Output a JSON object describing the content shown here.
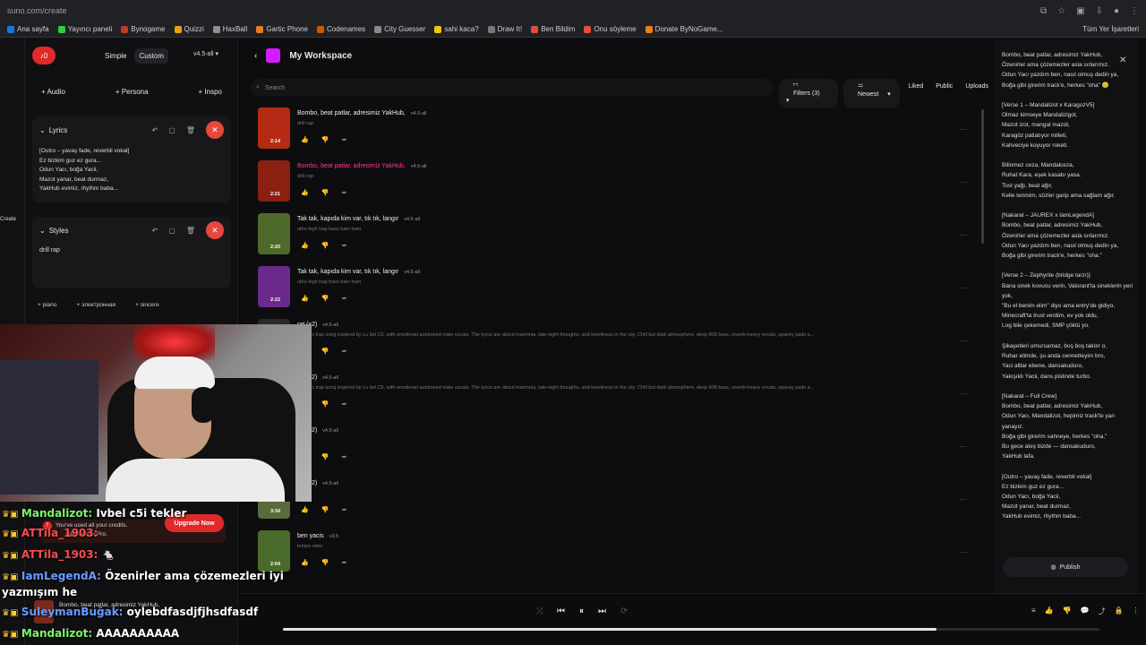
{
  "browser": {
    "url": "suno.com/create",
    "bookmarks": [
      "Ana sayfa",
      "Yayıncı paneli",
      "Bynogame",
      "Quizzi",
      "HaxBall",
      "Gartic Phone",
      "Codenames",
      "City Guesser",
      "sahi kaca?",
      "Draw It!",
      "Ben Bildim",
      "Onu söyleme",
      "Donate ByNoGame..."
    ],
    "bookmarks_right": "Tüm Yer İşaretleri"
  },
  "leftrail": {
    "create_label": "Create"
  },
  "creator": {
    "credits": "0",
    "mode_simple": "Simple",
    "mode_custom": "Custom",
    "version": "v4.5-all",
    "add_audio": "+ Audio",
    "add_persona": "+ Persona",
    "add_inspo": "+ Inspo",
    "lyrics_title": "Lyrics",
    "lyrics_text": "[Outro – yavaş fade, reverbli vokal]\nEz bizkim guz ez gura...\nOdun Yacı, boğa Yacii,\nMazot yanar, beat durmaz,\nYakHub evimiz, rhythm baba...",
    "styles_title": "Styles",
    "styles_text": "drill rap",
    "tags": [
      "+ piano",
      "+ электронная",
      "+ sincere"
    ]
  },
  "chat": [
    {
      "name": "Mandalizot:",
      "text": " Ivbel c5i tekler",
      "color": "green"
    },
    {
      "name": "ATTila_1903:",
      "text": " ",
      "color": "red"
    },
    {
      "name": "ATTila_1903:",
      "text": " 🐁",
      "color": "red"
    },
    {
      "name": "IamLegendA:",
      "text": " Özenirler ama çözemezleri iyi",
      "color": "blue"
    },
    {
      "name": "",
      "text": "yazmışım he",
      "color": "none"
    },
    {
      "name": "SuleymanBuğak:",
      "text": " oylebdfasdjfjhsdfasdf",
      "color": "blue"
    },
    {
      "name": "Mandalizot:",
      "text": " AAAAAAAAAA",
      "color": "green"
    }
  ],
  "toast": {
    "line1": "You've used all your credits.",
    "line2": "Upgrade to Pro.",
    "upgrade_label": "Upgrade Now"
  },
  "workspace": {
    "title": "My Workspace",
    "search_placeholder": "Search",
    "filters_label": "Filters (3)",
    "sort_label": "Newest",
    "liked": "Liked",
    "public": "Public",
    "uploads": "Uploads",
    "songs": [
      {
        "title": "Bombo, beat patlar, adresimiz YakHub,",
        "version": "v4.5-all",
        "desc": "drill rap",
        "duration": "2:14",
        "color": "#b52a14",
        "pink": false
      },
      {
        "title": "Bombo, beat patlar, adresimiz YakHub,",
        "version": "v4.5-all",
        "desc": "drill rap",
        "duration": "2:21",
        "color": "#8a1f12",
        "pink": true
      },
      {
        "title": "Tak tak, kapıda kim var, tık tık, langır",
        "version": "v4.5-all",
        "desc": "ultra high trap bass bam bam",
        "duration": "2:20",
        "color": "#4e6a2a",
        "pink": false
      },
      {
        "title": "Tak tak, kapıda kim var, tık tık, langır",
        "version": "v4.5-all",
        "desc": "ultra high trap bass bam bam",
        "duration": "2:22",
        "color": "#6a2a8a",
        "pink": false
      },
      {
        "title": "rat (x2)",
        "version": "v4.5-all",
        "desc": "melodic trap song inspired by Lu bel C5, with emotional autotuned male vocals. The lyrics are about insomnia, late-night thoughts, and loneliness in the city. Chill but dark atmosphere, deep 808 bass, reverb-heavy vocals, spacey pads a...",
        "duration": "",
        "color": "#2a2a2a",
        "pink": false
      },
      {
        "title": "rat (x2)",
        "version": "v4.5-all",
        "desc": "melodic trap song inspired by Lu bel C5, with emotional autotuned male vocals. The lyrics are about insomnia, late-night thoughts, and loneliness in the city. Chill but dark atmosphere, deep 808 bass, reverb-heavy vocals, spacey pads a...",
        "duration": "",
        "color": "#2a2a2a",
        "pink": false
      },
      {
        "title": "rat (x2)",
        "version": "v4.5-all",
        "desc": "vibe/",
        "duration": "",
        "color": "#2a2a2a",
        "pink": false
      },
      {
        "title": "rat (x2)",
        "version": "v4.5-all",
        "desc": "vibe/",
        "duration": "3:34",
        "color": "#5a6a3a",
        "pink": false
      },
      {
        "title": "ben yacis",
        "version": "v3.5",
        "desc": "tempo slow",
        "duration": "2:04",
        "color": "#4a6a2a",
        "pink": false
      }
    ]
  },
  "rightpanel": {
    "lyrics": "Bombo, beat patlar, adresimiz YakHub,\nÖzenirler ama çözemezler asla sırlarımız.\nOdun Yacı yazdım ben, nasıl olmuş dedin ya,\nBoğa gibi girerim track'e, herkes \"oha\" 😊\n\n[Verse 1 – Mandalizot x KaragozV5]\nOlmaz kimseye Mandalizigot,\nMazot izot, mangal mazot,\nKaragöz patlatıyor milleti,\nKahveciye koyuyor roketi.\n\nBilinmez ceza, Mandalceza,\nRuhat Kara, eşek kasabı yasa.\nTost yağı, beat ağır,\nKelle tenmim, sözler garip ama sağlam ağır.\n\n[Nakarat – JAUREX x IamLegendA]\nBombo, beat patlar, adresimiz YakHub,\nÖzenirler ama çözemezler asla sırlarımız.\nOdun Yacı yazdım ben, nasıl olmuş dedin ya,\nBoğa gibi girerim track'e, herkes \"oha.\"\n\n[Verse 2 – Zephyrite (bridge tarzı)]\nBana sinek kovucu verin, Valorant'ta sineklerin yeri yok,\n\"Bu el benim elim\" diyo ama entry'de gidiyo,\nMinecraft'ta trust verdim, ev yok oldu,\nLog bile çekemedi, SMP çöktü yo.\n\nŞikayetleri umursamaz, boş boş takılır o,\nRuhar elimde, şu anda cennetteyim bro,\nYaci altlar ebene, dansakuduro,\nYakışıklı Yacii, dans pistinde turbo.\n\n[Nakarat – Full Crew]\nBombo, beat patlar, adresimiz YakHub,\nOdun Yacı, Mandalizot, hepimiz track'te yan yanayız.\nBoğa gibi girerim sahneye, herkes \"oha,\"\nBu gece ateş bizde — dansakuduro,\nYakHub lafa.\n\n[Outro – yavaş fade, reverbli vokal]\nEz bizkim guz ez gura...\nOdun Yacı, boğa Yacii,\nMazot yanar, beat durmaz,\nYakHub evimiz, rhythm baba...",
    "publish": "Publish"
  },
  "player": {
    "now_playing": "Bombo, beat patlar, adresimiz YakHub,",
    "progress": 0.8
  }
}
